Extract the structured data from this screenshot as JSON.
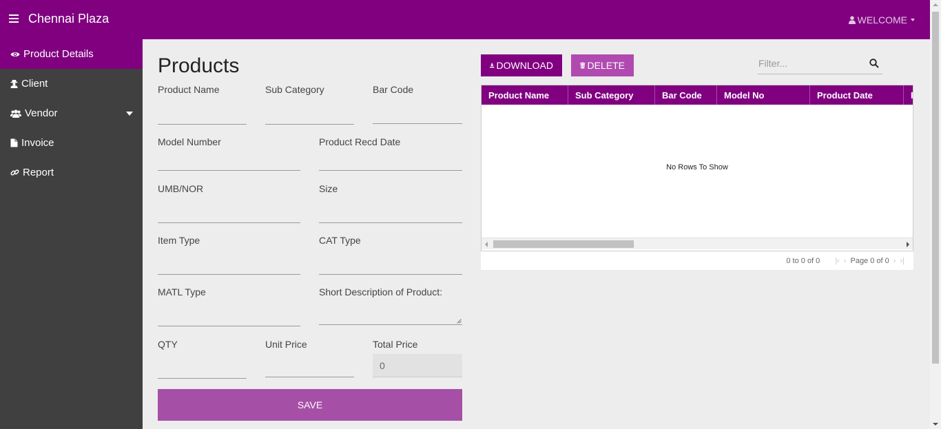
{
  "app": {
    "brand": "Chennai Plaza",
    "welcome": "WELCOME"
  },
  "colors": {
    "primary": "#800080",
    "sidebar": "#404040",
    "button_light": "#a64fa6"
  },
  "sidebar": {
    "items": [
      {
        "label": "Product Details",
        "icon": "eye-icon",
        "active": true
      },
      {
        "label": "Client",
        "icon": "user-secret-icon"
      },
      {
        "label": "Vendor",
        "icon": "users-icon",
        "has_dropdown": true
      },
      {
        "label": "Invoice",
        "icon": "file-icon"
      },
      {
        "label": "Report",
        "icon": "link-icon"
      }
    ]
  },
  "form": {
    "title": "Products",
    "fields": {
      "product_name": {
        "label": "Product Name",
        "value": ""
      },
      "sub_category": {
        "label": "Sub Category",
        "value": ""
      },
      "bar_code": {
        "label": "Bar Code",
        "value": ""
      },
      "model_number": {
        "label": "Model Number",
        "value": ""
      },
      "product_recd_date": {
        "label": "Product Recd Date",
        "value": ""
      },
      "umb_nor": {
        "label": "UMB/NOR",
        "value": ""
      },
      "size": {
        "label": "Size",
        "value": ""
      },
      "item_type": {
        "label": "Item Type",
        "value": ""
      },
      "cat_type": {
        "label": "CAT Type",
        "value": ""
      },
      "matl_type": {
        "label": "MATL Type",
        "value": ""
      },
      "short_description": {
        "label": "Short Description of Product:",
        "value": ""
      },
      "qty": {
        "label": "QTY",
        "value": ""
      },
      "unit_price": {
        "label": "Unit Price",
        "value": ""
      },
      "total_price": {
        "label": "Total Price",
        "value": "0"
      }
    },
    "save_label": "SAVE"
  },
  "grid": {
    "download_label": "DOWNLOAD",
    "delete_label": "DELETE",
    "filter_placeholder": "Filter...",
    "columns": [
      "Product Name",
      "Sub Category",
      "Bar Code",
      "Model No",
      "Product Date",
      "P"
    ],
    "no_rows": "No Rows To Show",
    "paging": {
      "summary": "0 to 0 of 0",
      "page": "Page 0 of 0"
    }
  }
}
